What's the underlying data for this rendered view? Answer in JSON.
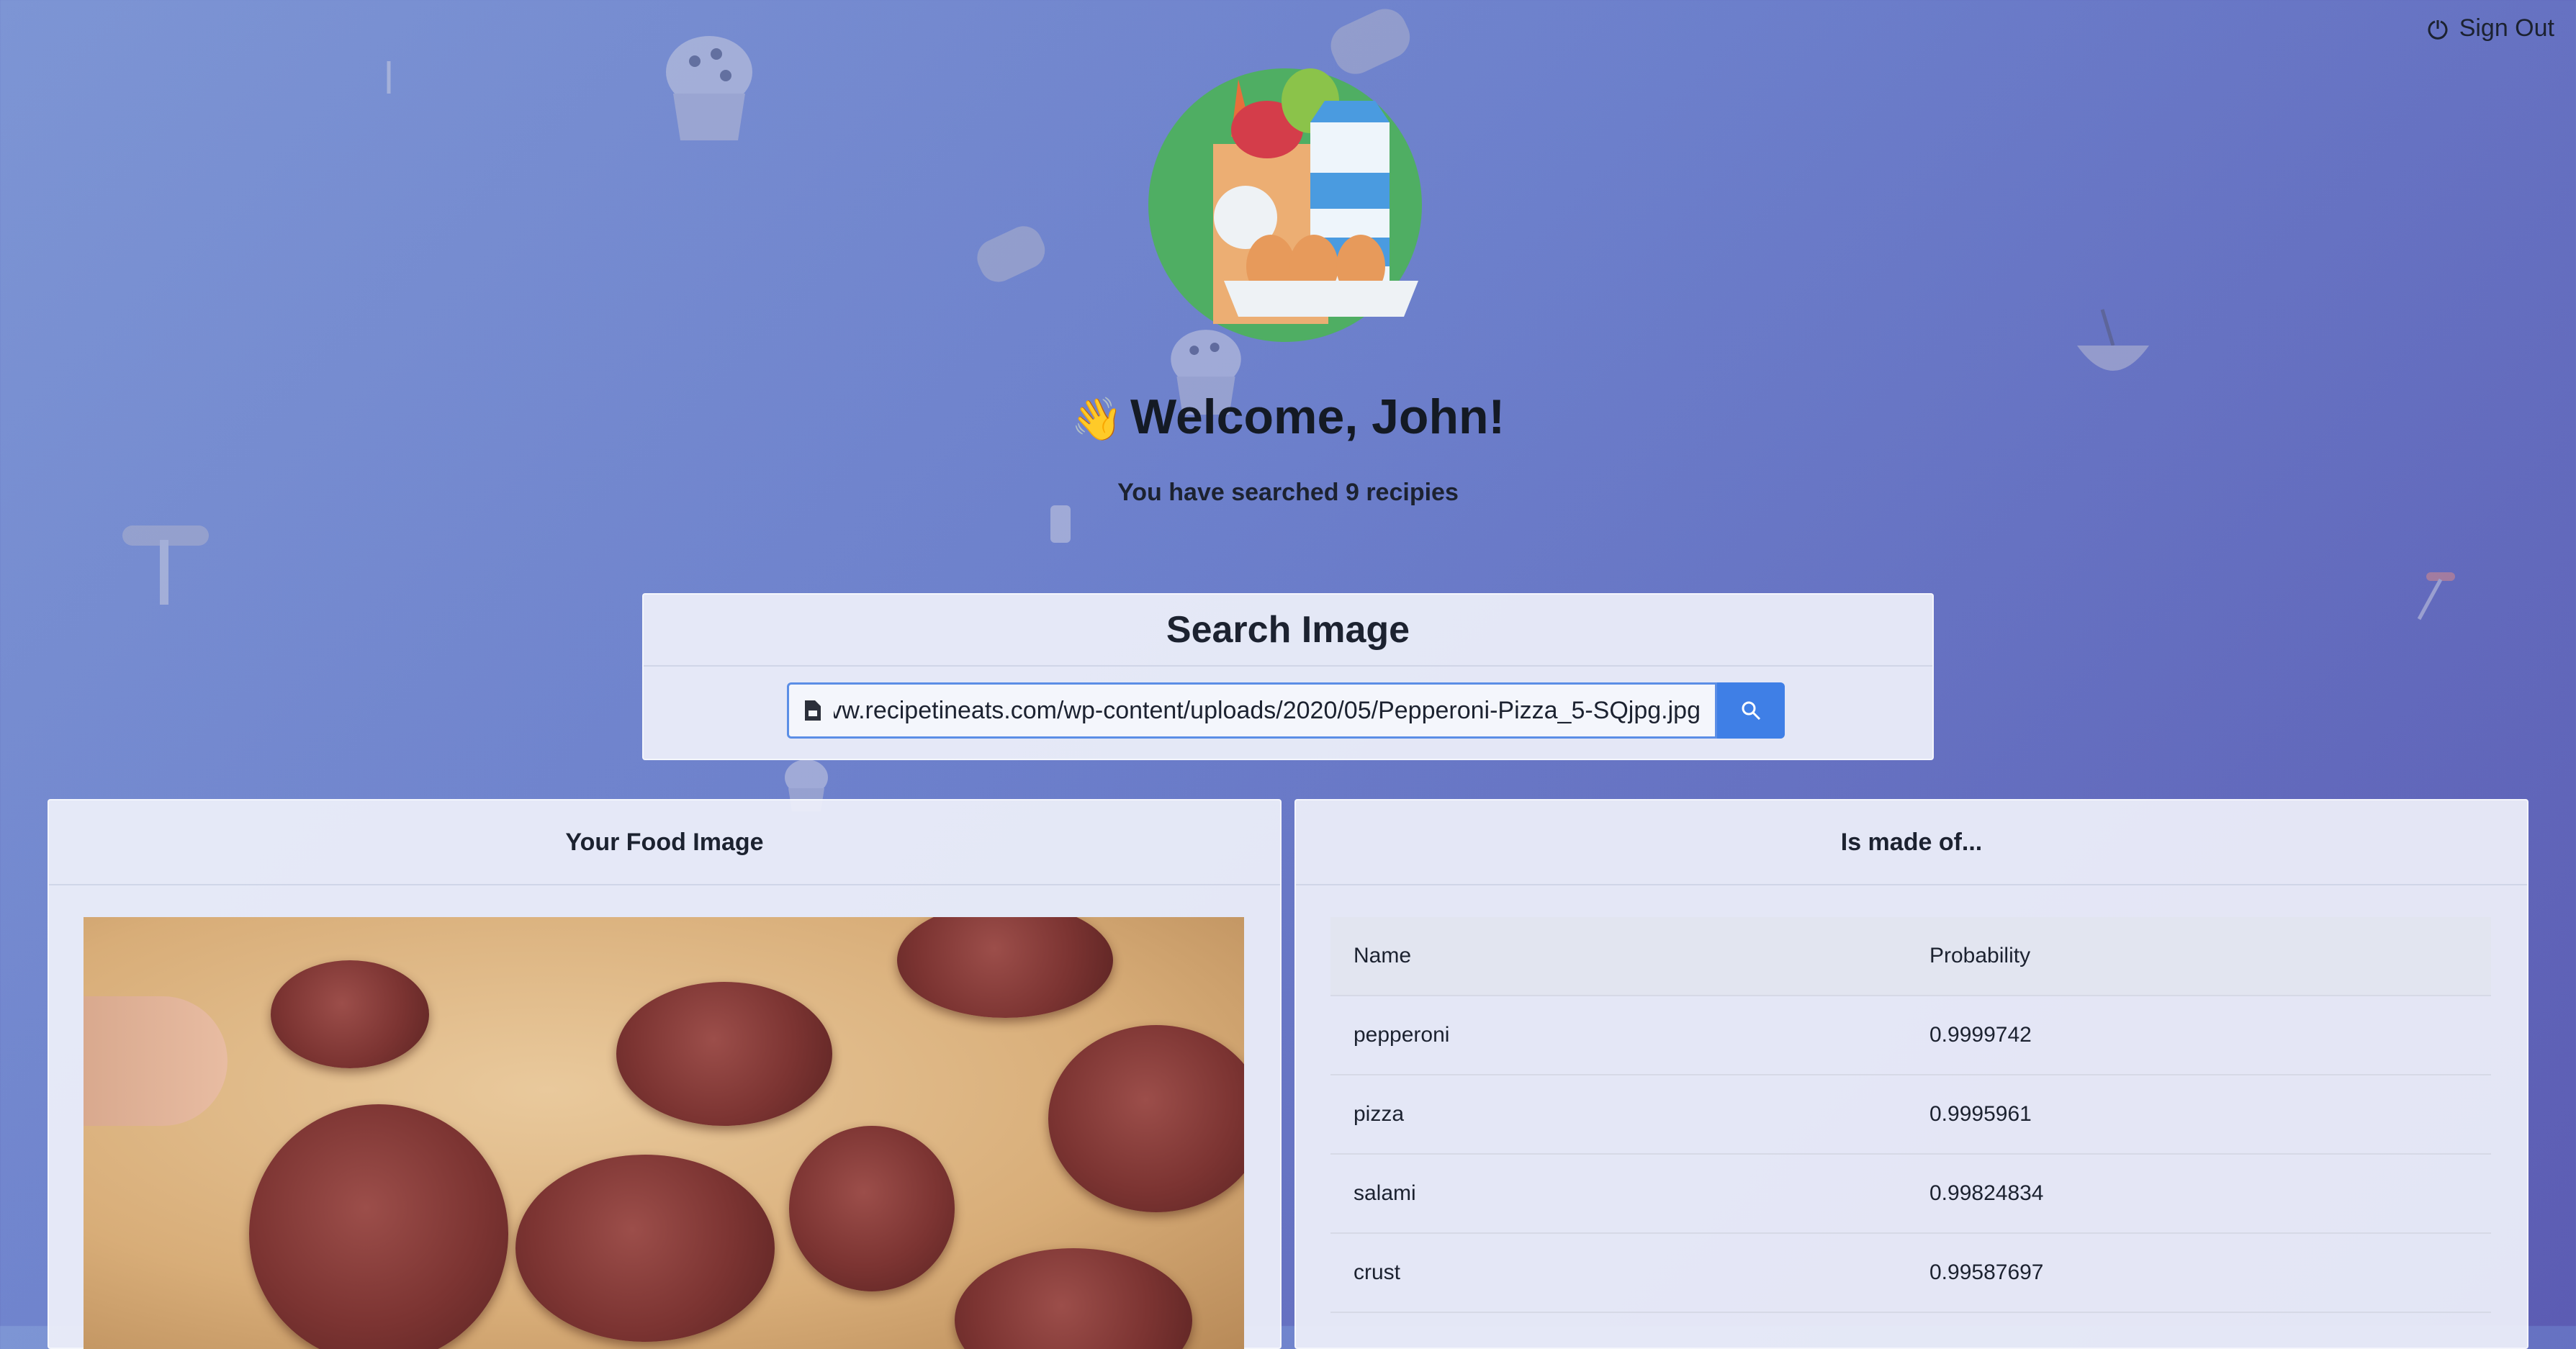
{
  "header": {
    "signout_label": "Sign Out"
  },
  "welcome": {
    "wave_emoji": "👋",
    "text": "Welcome, John!",
    "subtitle": "You have searched 9 recipies"
  },
  "search": {
    "title": "Search Image",
    "input_value": "vw.recipetineats.com/wp-content/uploads/2020/05/Pepperoni-Pizza_5-SQjpg.jpg",
    "button_icon": "search-icon"
  },
  "left_panel": {
    "title": "Your Food Image"
  },
  "right_panel": {
    "title": "Is made of...",
    "columns": [
      "Name",
      "Probability"
    ],
    "rows": [
      {
        "name": "pepperoni",
        "probability": "0.9999742"
      },
      {
        "name": "pizza",
        "probability": "0.9995961"
      },
      {
        "name": "salami",
        "probability": "0.99824834"
      },
      {
        "name": "crust",
        "probability": "0.99587697"
      }
    ]
  },
  "colors": {
    "accent": "#3f7fe6",
    "background_start": "#7d95d4",
    "background_end": "#5c5cb3"
  }
}
